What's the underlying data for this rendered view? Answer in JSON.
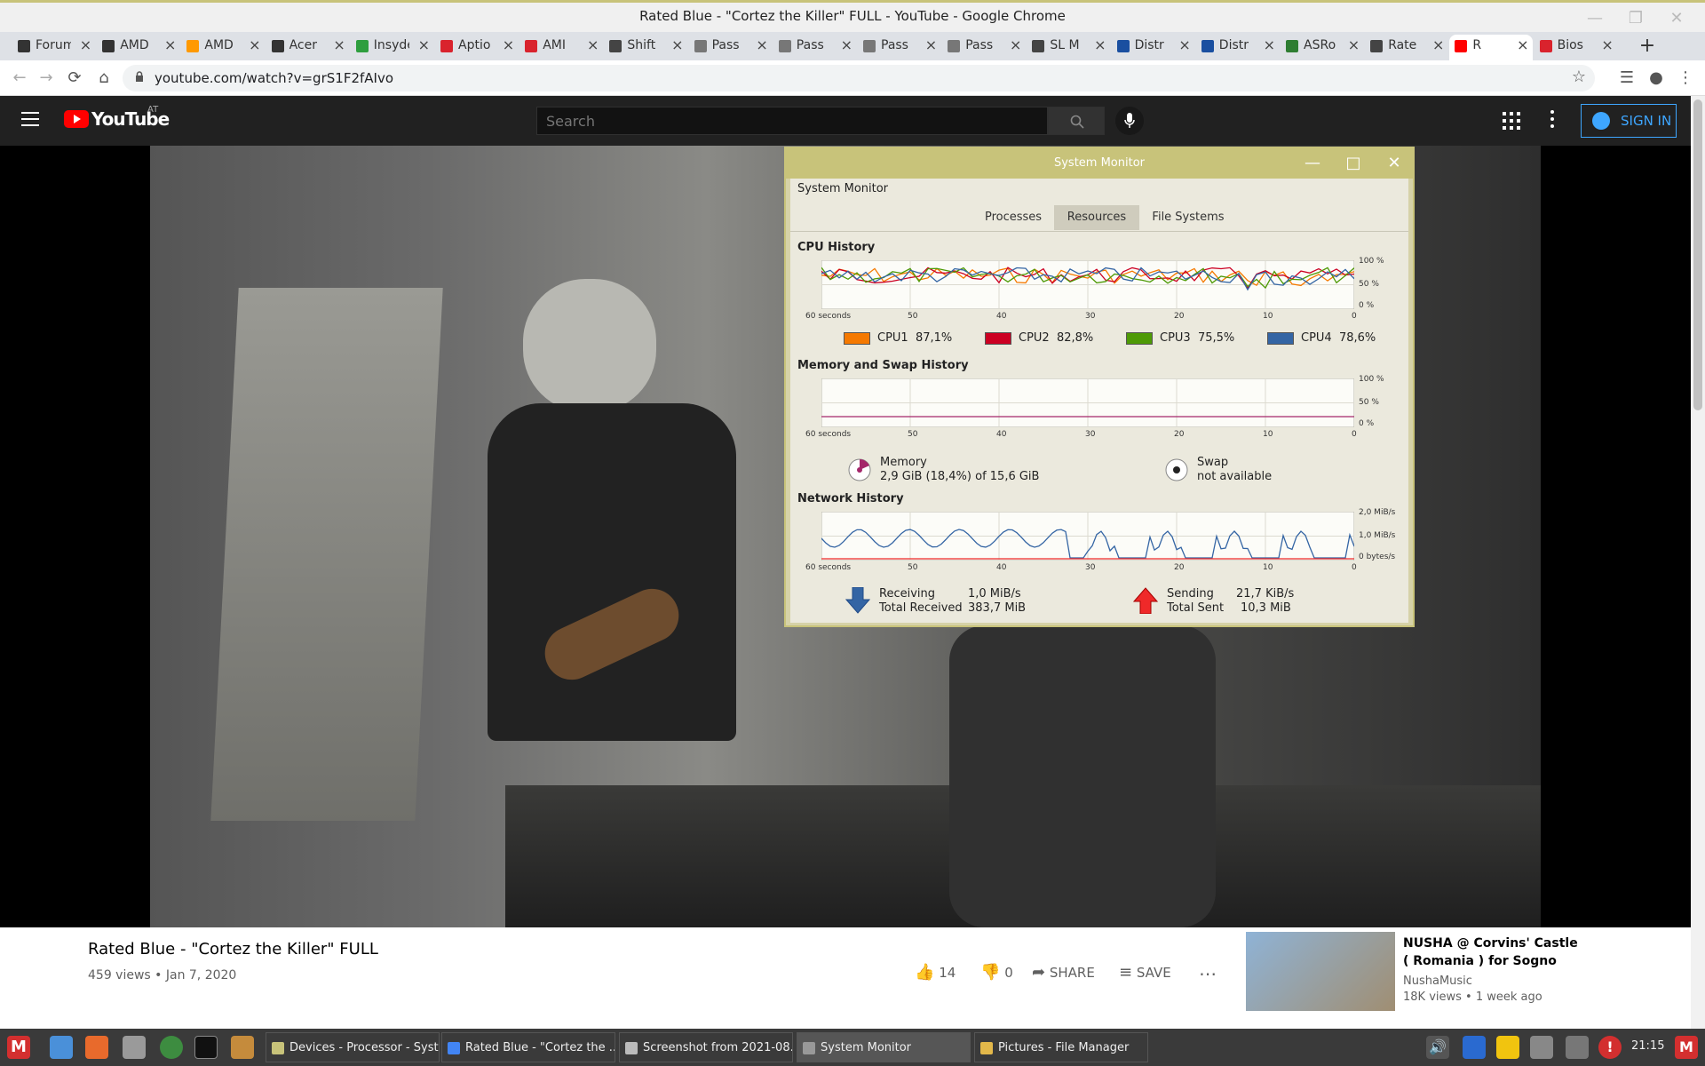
{
  "window": {
    "title": "Rated Blue - \"Cortez the Killer\" FULL - YouTube - Google Chrome"
  },
  "tabs": [
    {
      "label": "Forum",
      "color": "#333333"
    },
    {
      "label": "AMD",
      "color": "#333333"
    },
    {
      "label": "AMD",
      "color": "#ff9900"
    },
    {
      "label": "Acer",
      "color": "#333333"
    },
    {
      "label": "Insyde",
      "color": "#2e9e3e"
    },
    {
      "label": "Aptio",
      "color": "#d9232d"
    },
    {
      "label": "AMI",
      "color": "#d9232d"
    },
    {
      "label": "Shift",
      "color": "#444444"
    },
    {
      "label": "Pass",
      "color": "#777777"
    },
    {
      "label": "Pass",
      "color": "#777777"
    },
    {
      "label": "Pass",
      "color": "#777777"
    },
    {
      "label": "Pass",
      "color": "#777777"
    },
    {
      "label": "SL M",
      "color": "#444444"
    },
    {
      "label": "Distr",
      "color": "#1a4fa0"
    },
    {
      "label": "Distr",
      "color": "#1a4fa0"
    },
    {
      "label": "ASRo",
      "color": "#2e7d32"
    },
    {
      "label": "Rate",
      "color": "#444444"
    },
    {
      "label": "R",
      "color": "#ff0000"
    },
    {
      "label": "Bios",
      "color": "#d9232d"
    }
  ],
  "address": {
    "url": "youtube.com/watch?v=grS1F2fAIvo"
  },
  "youtube": {
    "country": "AT",
    "brand": "YouTube",
    "search_placeholder": "Search",
    "sign_in": "SIGN IN"
  },
  "video": {
    "title": "Rated Blue - \"Cortez the Killer\" FULL",
    "views": "459 views • Jan 7, 2020",
    "likes": "14",
    "dislikes": "0",
    "share": "SHARE",
    "save": "SAVE"
  },
  "recommendation": {
    "title": "NUSHA @ Corvins' Castle ( Romania ) for Sogno",
    "channel": "NushaMusic",
    "views": "18K views • 1 week ago"
  },
  "sysmon": {
    "title": "System Monitor",
    "menu": "System Monitor",
    "tabs": [
      "Processes",
      "Resources",
      "File Systems"
    ],
    "active_tab": "Resources",
    "cpu_section": "CPU History",
    "mem_section": "Memory and Swap History",
    "net_section": "Network History",
    "x_ticks": [
      "60 seconds",
      "50",
      "40",
      "30",
      "20",
      "10",
      "0"
    ],
    "pct_ticks": [
      "100 %",
      "50 %",
      "0 %"
    ],
    "net_ticks": [
      "2,0 MiB/s",
      "1,0 MiB/s",
      "0 bytes/s"
    ],
    "cpus": [
      {
        "label": "CPU1",
        "value": "87,1%",
        "color": "#f57900"
      },
      {
        "label": "CPU2",
        "value": "82,8%",
        "color": "#cc0022"
      },
      {
        "label": "CPU3",
        "value": "75,5%",
        "color": "#4e9a06"
      },
      {
        "label": "CPU4",
        "value": "78,6%",
        "color": "#3465a4"
      }
    ],
    "memory": {
      "label": "Memory",
      "value": "2,9 GiB (18,4%) of 15,6 GiB",
      "color": "#a4266a"
    },
    "swap": {
      "label": "Swap",
      "value": "not available"
    },
    "receiving": {
      "label": "Receiving",
      "rate": "1,0 MiB/s",
      "total_label": "Total Received",
      "total": "383,7 MiB"
    },
    "sending": {
      "label": "Sending",
      "rate": "21,7 KiB/s",
      "total_label": "Total Sent",
      "total": "10,3 MiB"
    }
  },
  "taskbar": {
    "items": [
      {
        "label": "Devices - Processor - Syst...",
        "color": "#c8c37a"
      },
      {
        "label": "Rated Blue - \"Cortez the ...",
        "color": "#4285f4"
      },
      {
        "label": "Screenshot from 2021-08...",
        "color": "#bbbbbb"
      },
      {
        "label": "System Monitor",
        "color": "#999999"
      },
      {
        "label": "Pictures - File Manager",
        "color": "#e3b84a"
      }
    ],
    "clock": "21:15"
  }
}
